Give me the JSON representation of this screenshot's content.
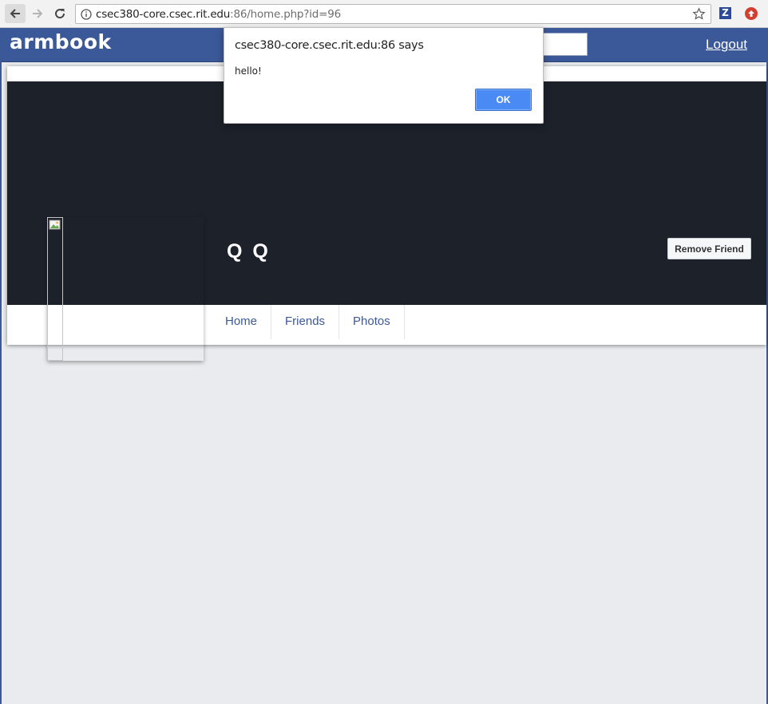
{
  "browser": {
    "url_host": "csec380-core.csec.rit.edu",
    "url_rest": ":86/home.php?id=96",
    "extension_z_label": "Z"
  },
  "header": {
    "brand": "armbook",
    "logout_label": "Logout"
  },
  "profile": {
    "name": "Q Q",
    "remove_friend_label": "Remove Friend",
    "tabs": [
      {
        "label": "Home"
      },
      {
        "label": "Friends"
      },
      {
        "label": "Photos"
      }
    ]
  },
  "alert": {
    "title": "csec380-core.csec.rit.edu:86 says",
    "message": "hello!",
    "ok_label": "OK"
  },
  "colors": {
    "brand_blue": "#3b5998",
    "cover_dark": "#1d212a",
    "page_bg": "#e9ebee",
    "ok_blue": "#4a8af4"
  }
}
